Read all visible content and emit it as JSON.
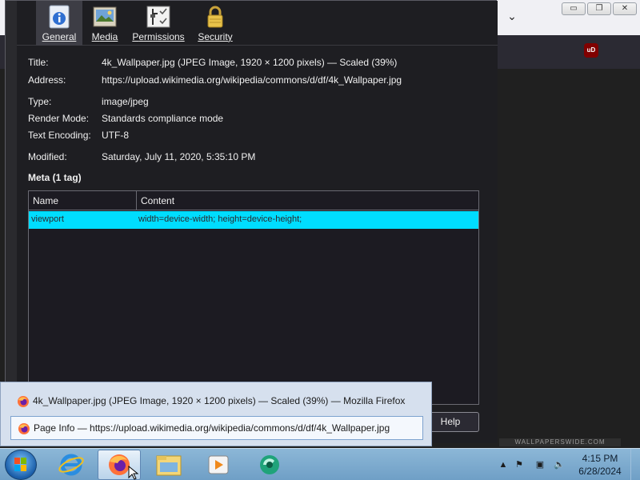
{
  "background_window": {
    "minimize_glyph": "▭",
    "restore_glyph": "❐",
    "close_glyph": "✕",
    "chevron_glyph": "⌄",
    "toolbar_icons": [
      "pocket-icon",
      "extensions-icon",
      "ublock-icon",
      "menu-icon"
    ],
    "ublock_label": "uD",
    "watermark": "WALLPAPERSWIDE.COM"
  },
  "dialog": {
    "tabs": [
      {
        "label_first": "G",
        "label_rest": "eneral",
        "icon": "info-icon"
      },
      {
        "label_first": "M",
        "label_rest": "edia",
        "icon": "media-icon"
      },
      {
        "label_first": "P",
        "label_rest": "ermissions",
        "icon": "permissions-icon"
      },
      {
        "label_first": "S",
        "label_rest": "ecurity",
        "icon": "lock-icon"
      }
    ],
    "fields": {
      "title_label": "Title:",
      "title_value": "4k_Wallpaper.jpg (JPEG Image, 1920 × 1200 pixels) — Scaled (39%)",
      "address_label": "Address:",
      "address_value": "https://upload.wikimedia.org/wikipedia/commons/d/df/4k_Wallpaper.jpg",
      "type_label": "Type:",
      "type_value": "image/jpeg",
      "render_label": "Render Mode:",
      "render_value": "Standards compliance mode",
      "encoding_label": "Text Encoding:",
      "encoding_value": "UTF-8",
      "modified_label": "Modified:",
      "modified_value": "Saturday, July 11, 2020, 5:35:10 PM"
    },
    "meta_title": "Meta (1 tag)",
    "table": {
      "headers": [
        "Name",
        "Content"
      ],
      "rows": [
        {
          "name": "viewport",
          "content": "width=device-width; height=device-height;"
        }
      ]
    },
    "help_button": "Help"
  },
  "popup": {
    "items": [
      {
        "text": "4k_Wallpaper.jpg (JPEG Image, 1920 × 1200 pixels) — Scaled (39%) — Mozilla Firefox"
      },
      {
        "text": "Page Info — https://upload.wikimedia.org/wikipedia/commons/d/df/4k_Wallpaper.jpg"
      }
    ]
  },
  "taskbar": {
    "time": "4:15 PM",
    "date": "6/28/2024",
    "apps": [
      "internet-explorer-icon",
      "firefox-icon",
      "file-explorer-icon",
      "media-player-icon",
      "app-icon"
    ]
  }
}
